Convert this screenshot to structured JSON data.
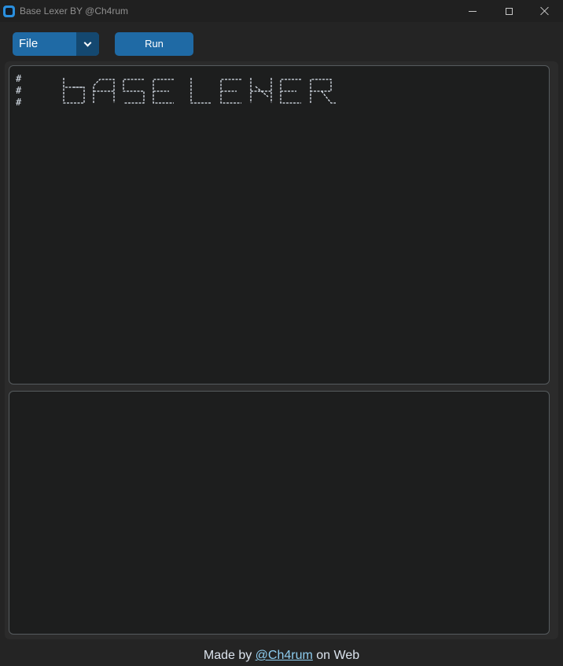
{
  "window": {
    "title": "Base Lexer BY @Ch4rum",
    "icon": "app-icon"
  },
  "toolbar": {
    "file_label": "File",
    "run_label": "Run"
  },
  "editor": {
    "hash_lines": [
      "#",
      "#",
      "#"
    ],
    "banner_text": "BASELEXER"
  },
  "output": {
    "text": ""
  },
  "footer": {
    "prefix": "Made by ",
    "link_text": "@Ch4rum",
    "suffix": " on Web"
  },
  "colors": {
    "accent": "#1f6aa5",
    "accent_dark": "#144870",
    "background": "#242424",
    "textbox": "#1d1e1e",
    "link": "#8ecdf0"
  }
}
